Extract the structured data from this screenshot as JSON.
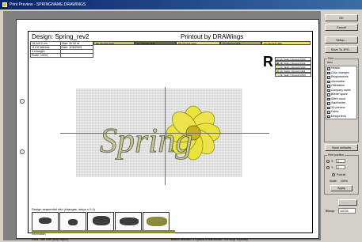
{
  "window": {
    "title": "Print Preview - SPRINGNAME.DRAWINGS"
  },
  "paper": {
    "design_title": "Design: Spring_rev2",
    "printout_title": "Printout by DRAWings",
    "info_rows": [
      [
        "18.0x5.0 cm",
        "Start: 30.00 st"
      ],
      [
        "11102 stitches",
        "Date: 11/6/2009"
      ],
      [
        "4 changes",
        ""
      ],
      [
        "Scale: 100%",
        ""
      ]
    ],
    "threads": [
      {
        "label": "1E: Duncoli 1130",
        "color": "#c7c76a"
      },
      {
        "label": "1D: Duncoli 1131",
        "color": "#6b6b39"
      },
      {
        "label": "1B: Duncoli 1134",
        "color": "#e4e048"
      },
      {
        "label": "1C: Duncoli 1116",
        "color": "#aaaa55"
      },
      {
        "label": "1A: Duncoli 1000",
        "color": "#f6f000"
      }
    ],
    "big_letter": "R",
    "legend": [
      {
        "label": "1A: Sulky | Duncoli 1130",
        "color": "#c7c76a"
      },
      {
        "label": "1B: Sulky | Duncoli 1131",
        "color": "#6b6b39"
      },
      {
        "label": "1C: Sulky | Duncoli 1134",
        "color": "#e4e048"
      },
      {
        "label": "1D: Sulky | Duncoli 1116",
        "color": "#aaaa55"
      },
      {
        "label": "1E: Sulky | Duncoli 1000",
        "color": "#f6f000"
      }
    ],
    "design_text": "Spring",
    "sequence_label": "Design sequential info (changes, steps x 1:1)",
    "sequence_meta": "Information",
    "footer_left": "Extra - see note (hoop object)",
    "footer_right": "Bottom direction: 3 Options of this events: 'The hoop' in priority"
  },
  "panel": {
    "buttons": {
      "ok": "OK",
      "cancel": "Cancel",
      "setup": "Setup...",
      "save_pdf": "Save To JPG...",
      "zoom": "Zoom 1:1",
      "apply": "Apply"
    },
    "print_group": "Print",
    "items_group": "Item",
    "items": [
      {
        "label": "Header",
        "checked": true
      },
      {
        "label": "Color changes",
        "checked": true
      },
      {
        "label": "Requirements",
        "checked": true
      },
      {
        "label": "Information",
        "checked": true
      },
      {
        "label": "Orientation",
        "checked": true
      },
      {
        "label": "Company name",
        "checked": true
      },
      {
        "label": "Border space",
        "checked": true
      },
      {
        "label": "Stitch count",
        "checked": true
      },
      {
        "label": "Start/center",
        "checked": true
      },
      {
        "label": "3D preview",
        "checked": true
      },
      {
        "label": "Fabric",
        "checked": true
      },
      {
        "label": "Design lines",
        "checked": true
      }
    ],
    "save_defaults": "Save defaults",
    "print_position_group": "Print position",
    "x_label": "X:",
    "x_value": "0",
    "y_label": "Y:",
    "y_value": "0",
    "portrait_label": "Portrait",
    "scale_label": "Scale:",
    "scale_value": "100%",
    "bitmap_label": "Bitmap:",
    "bitmap_value": "100.00"
  }
}
